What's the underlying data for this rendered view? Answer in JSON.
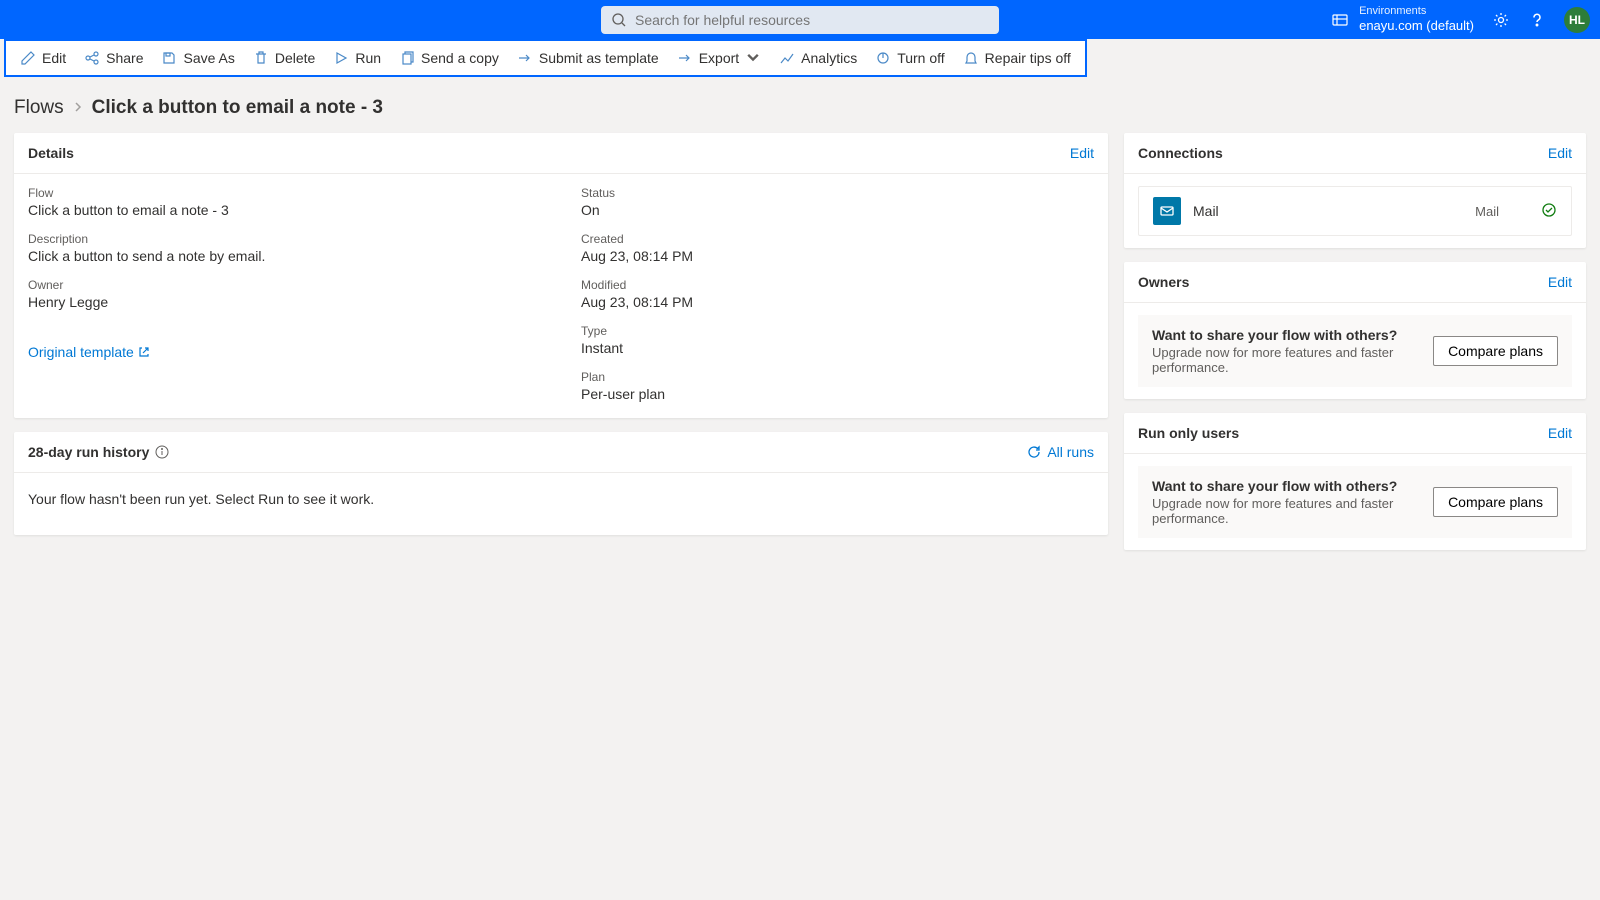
{
  "header": {
    "search_placeholder": "Search for helpful resources",
    "env_label": "Environments",
    "env_name": "enayu.com (default)",
    "avatar_initials": "HL"
  },
  "toolbar": {
    "edit": "Edit",
    "share": "Share",
    "save_as": "Save As",
    "delete": "Delete",
    "run": "Run",
    "send_copy": "Send a copy",
    "submit_template": "Submit as template",
    "export": "Export",
    "analytics": "Analytics",
    "turn_off": "Turn off",
    "repair_tips": "Repair tips off"
  },
  "breadcrumb": {
    "root": "Flows",
    "current": "Click a button to email a note - 3"
  },
  "details": {
    "title": "Details",
    "edit": "Edit",
    "flow_label": "Flow",
    "flow_value": "Click a button to email a note - 3",
    "desc_label": "Description",
    "desc_value": "Click a button to send a note by email.",
    "owner_label": "Owner",
    "owner_value": "Henry Legge",
    "status_label": "Status",
    "status_value": "On",
    "created_label": "Created",
    "created_value": "Aug 23, 08:14 PM",
    "modified_label": "Modified",
    "modified_value": "Aug 23, 08:14 PM",
    "type_label": "Type",
    "type_value": "Instant",
    "plan_label": "Plan",
    "plan_value": "Per-user plan",
    "template_link": "Original template"
  },
  "history": {
    "title": "28-day run history",
    "all_runs": "All runs",
    "empty": "Your flow hasn't been run yet. Select Run to see it work."
  },
  "connections": {
    "title": "Connections",
    "edit": "Edit",
    "item_name": "Mail",
    "item_type": "Mail"
  },
  "owners": {
    "title": "Owners",
    "edit": "Edit"
  },
  "run_only": {
    "title": "Run only users",
    "edit": "Edit"
  },
  "upsell": {
    "title": "Want to share your flow with others?",
    "desc": "Upgrade now for more features and faster performance.",
    "button": "Compare plans"
  }
}
